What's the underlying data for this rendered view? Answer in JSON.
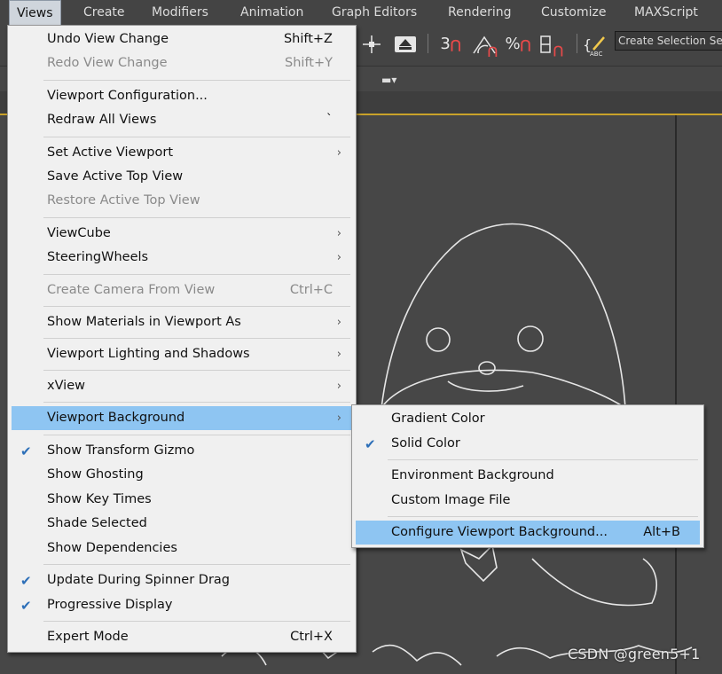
{
  "menubar": {
    "items": [
      "Views",
      "Create",
      "Modifiers",
      "Animation",
      "Graph Editors",
      "Rendering",
      "Customize",
      "MAXScript"
    ],
    "active": "Views"
  },
  "toolbar": {
    "selection_set_placeholder": "Create Selection Se",
    "snap_buttons": [
      "3",
      "%",
      "⁀"
    ]
  },
  "views_menu": {
    "items": [
      {
        "label": "Undo View Change",
        "shortcut": "Shift+Z",
        "enabled": true
      },
      {
        "label": "Redo View Change",
        "shortcut": "Shift+Y",
        "enabled": false
      },
      {
        "label": "Viewport Configuration...",
        "enabled": true
      },
      {
        "label": "Redraw All Views",
        "shortcut": "`",
        "enabled": true
      },
      {
        "label": "Set Active Viewport",
        "submenu": true,
        "enabled": true
      },
      {
        "label": "Save Active Top View",
        "enabled": true
      },
      {
        "label": "Restore Active Top View",
        "enabled": false
      },
      {
        "label": "ViewCube",
        "submenu": true,
        "enabled": true
      },
      {
        "label": "SteeringWheels",
        "submenu": true,
        "enabled": true
      },
      {
        "label": "Create Camera From View",
        "shortcut": "Ctrl+C",
        "enabled": false
      },
      {
        "label": "Show Materials in Viewport As",
        "submenu": true,
        "enabled": true
      },
      {
        "label": "Viewport Lighting and Shadows",
        "submenu": true,
        "enabled": true
      },
      {
        "label": "xView",
        "submenu": true,
        "enabled": true
      },
      {
        "label": "Viewport Background",
        "submenu": true,
        "enabled": true,
        "highlighted": true
      },
      {
        "label": "Show Transform Gizmo",
        "checked": true,
        "enabled": true
      },
      {
        "label": "Show Ghosting",
        "enabled": true
      },
      {
        "label": "Show Key Times",
        "enabled": true
      },
      {
        "label": "Shade Selected",
        "enabled": true
      },
      {
        "label": "Show Dependencies",
        "enabled": true
      },
      {
        "label": "Update During Spinner Drag",
        "checked": true,
        "enabled": true
      },
      {
        "label": "Progressive Display",
        "checked": true,
        "enabled": true
      },
      {
        "label": "Expert Mode",
        "shortcut": "Ctrl+X",
        "enabled": true
      }
    ]
  },
  "background_submenu": {
    "items": [
      {
        "label": "Gradient Color"
      },
      {
        "label": "Solid Color",
        "checked": true
      },
      {
        "label": "Environment Background"
      },
      {
        "label": "Custom Image File"
      },
      {
        "label": "Configure Viewport Background...",
        "shortcut": "Alt+B",
        "highlighted": true
      }
    ]
  },
  "watermark": "CSDN @green5+1",
  "colors": {
    "menu_bg": "#f0f0f0",
    "highlight": "#8ec5f2",
    "ui_dark": "#444444",
    "viewport_line": "#e6e6e6",
    "active_border": "#c9a22a"
  }
}
